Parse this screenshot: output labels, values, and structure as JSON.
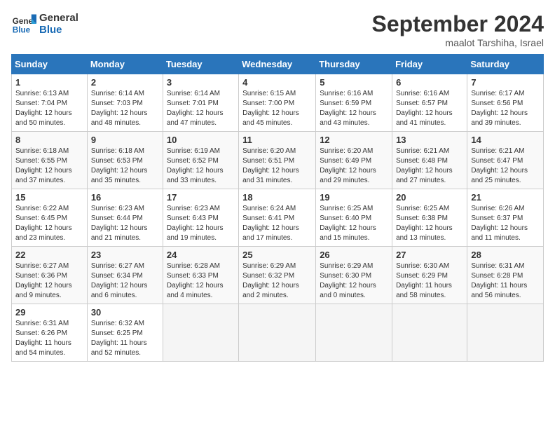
{
  "header": {
    "logo_line1": "General",
    "logo_line2": "Blue",
    "month": "September 2024",
    "location": "maalot Tarshiha, Israel"
  },
  "weekdays": [
    "Sunday",
    "Monday",
    "Tuesday",
    "Wednesday",
    "Thursday",
    "Friday",
    "Saturday"
  ],
  "weeks": [
    [
      {
        "day": "1",
        "info": "Sunrise: 6:13 AM\nSunset: 7:04 PM\nDaylight: 12 hours\nand 50 minutes."
      },
      {
        "day": "2",
        "info": "Sunrise: 6:14 AM\nSunset: 7:03 PM\nDaylight: 12 hours\nand 48 minutes."
      },
      {
        "day": "3",
        "info": "Sunrise: 6:14 AM\nSunset: 7:01 PM\nDaylight: 12 hours\nand 47 minutes."
      },
      {
        "day": "4",
        "info": "Sunrise: 6:15 AM\nSunset: 7:00 PM\nDaylight: 12 hours\nand 45 minutes."
      },
      {
        "day": "5",
        "info": "Sunrise: 6:16 AM\nSunset: 6:59 PM\nDaylight: 12 hours\nand 43 minutes."
      },
      {
        "day": "6",
        "info": "Sunrise: 6:16 AM\nSunset: 6:57 PM\nDaylight: 12 hours\nand 41 minutes."
      },
      {
        "day": "7",
        "info": "Sunrise: 6:17 AM\nSunset: 6:56 PM\nDaylight: 12 hours\nand 39 minutes."
      }
    ],
    [
      {
        "day": "8",
        "info": "Sunrise: 6:18 AM\nSunset: 6:55 PM\nDaylight: 12 hours\nand 37 minutes."
      },
      {
        "day": "9",
        "info": "Sunrise: 6:18 AM\nSunset: 6:53 PM\nDaylight: 12 hours\nand 35 minutes."
      },
      {
        "day": "10",
        "info": "Sunrise: 6:19 AM\nSunset: 6:52 PM\nDaylight: 12 hours\nand 33 minutes."
      },
      {
        "day": "11",
        "info": "Sunrise: 6:20 AM\nSunset: 6:51 PM\nDaylight: 12 hours\nand 31 minutes."
      },
      {
        "day": "12",
        "info": "Sunrise: 6:20 AM\nSunset: 6:49 PM\nDaylight: 12 hours\nand 29 minutes."
      },
      {
        "day": "13",
        "info": "Sunrise: 6:21 AM\nSunset: 6:48 PM\nDaylight: 12 hours\nand 27 minutes."
      },
      {
        "day": "14",
        "info": "Sunrise: 6:21 AM\nSunset: 6:47 PM\nDaylight: 12 hours\nand 25 minutes."
      }
    ],
    [
      {
        "day": "15",
        "info": "Sunrise: 6:22 AM\nSunset: 6:45 PM\nDaylight: 12 hours\nand 23 minutes."
      },
      {
        "day": "16",
        "info": "Sunrise: 6:23 AM\nSunset: 6:44 PM\nDaylight: 12 hours\nand 21 minutes."
      },
      {
        "day": "17",
        "info": "Sunrise: 6:23 AM\nSunset: 6:43 PM\nDaylight: 12 hours\nand 19 minutes."
      },
      {
        "day": "18",
        "info": "Sunrise: 6:24 AM\nSunset: 6:41 PM\nDaylight: 12 hours\nand 17 minutes."
      },
      {
        "day": "19",
        "info": "Sunrise: 6:25 AM\nSunset: 6:40 PM\nDaylight: 12 hours\nand 15 minutes."
      },
      {
        "day": "20",
        "info": "Sunrise: 6:25 AM\nSunset: 6:38 PM\nDaylight: 12 hours\nand 13 minutes."
      },
      {
        "day": "21",
        "info": "Sunrise: 6:26 AM\nSunset: 6:37 PM\nDaylight: 12 hours\nand 11 minutes."
      }
    ],
    [
      {
        "day": "22",
        "info": "Sunrise: 6:27 AM\nSunset: 6:36 PM\nDaylight: 12 hours\nand 9 minutes."
      },
      {
        "day": "23",
        "info": "Sunrise: 6:27 AM\nSunset: 6:34 PM\nDaylight: 12 hours\nand 6 minutes."
      },
      {
        "day": "24",
        "info": "Sunrise: 6:28 AM\nSunset: 6:33 PM\nDaylight: 12 hours\nand 4 minutes."
      },
      {
        "day": "25",
        "info": "Sunrise: 6:29 AM\nSunset: 6:32 PM\nDaylight: 12 hours\nand 2 minutes."
      },
      {
        "day": "26",
        "info": "Sunrise: 6:29 AM\nSunset: 6:30 PM\nDaylight: 12 hours\nand 0 minutes."
      },
      {
        "day": "27",
        "info": "Sunrise: 6:30 AM\nSunset: 6:29 PM\nDaylight: 11 hours\nand 58 minutes."
      },
      {
        "day": "28",
        "info": "Sunrise: 6:31 AM\nSunset: 6:28 PM\nDaylight: 11 hours\nand 56 minutes."
      }
    ],
    [
      {
        "day": "29",
        "info": "Sunrise: 6:31 AM\nSunset: 6:26 PM\nDaylight: 11 hours\nand 54 minutes."
      },
      {
        "day": "30",
        "info": "Sunrise: 6:32 AM\nSunset: 6:25 PM\nDaylight: 11 hours\nand 52 minutes."
      },
      null,
      null,
      null,
      null,
      null
    ]
  ]
}
